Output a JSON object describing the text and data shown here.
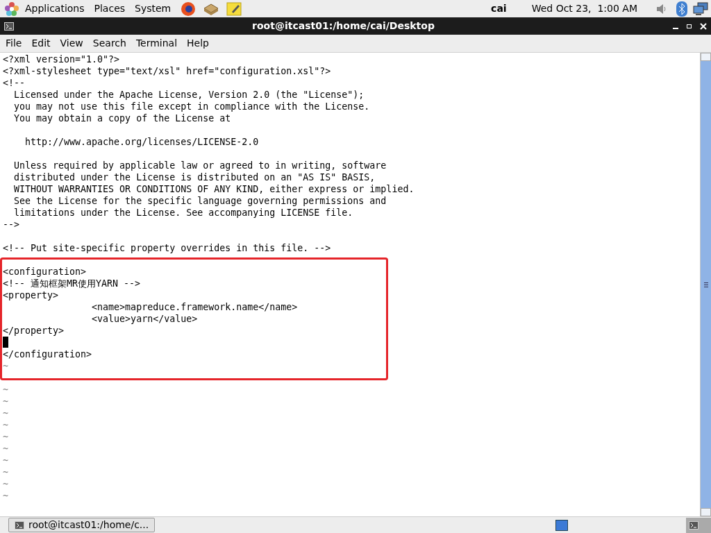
{
  "top_panel": {
    "menus": [
      "Applications",
      "Places",
      "System"
    ],
    "user": "cai",
    "clock": "Wed Oct 23,  1:00 AM"
  },
  "window": {
    "title": "root@itcast01:/home/cai/Desktop"
  },
  "menubar": [
    "File",
    "Edit",
    "View",
    "Search",
    "Terminal",
    "Help"
  ],
  "terminal": {
    "lines": [
      {
        "kind": "text",
        "text": "<?xml version=\"1.0\"?>"
      },
      {
        "kind": "text",
        "text": "<?xml-stylesheet type=\"text/xsl\" href=\"configuration.xsl\"?>"
      },
      {
        "kind": "text",
        "text": "<!--"
      },
      {
        "kind": "text",
        "text": "  Licensed under the Apache License, Version 2.0 (the \"License\");"
      },
      {
        "kind": "text",
        "text": "  you may not use this file except in compliance with the License."
      },
      {
        "kind": "text",
        "text": "  You may obtain a copy of the License at"
      },
      {
        "kind": "blank"
      },
      {
        "kind": "text",
        "text": "    http://www.apache.org/licenses/LICENSE-2.0"
      },
      {
        "kind": "blank"
      },
      {
        "kind": "text",
        "text": "  Unless required by applicable law or agreed to in writing, software"
      },
      {
        "kind": "text",
        "text": "  distributed under the License is distributed on an \"AS IS\" BASIS,"
      },
      {
        "kind": "text",
        "text": "  WITHOUT WARRANTIES OR CONDITIONS OF ANY KIND, either express or implied."
      },
      {
        "kind": "text",
        "text": "  See the License for the specific language governing permissions and"
      },
      {
        "kind": "text",
        "text": "  limitations under the License. See accompanying LICENSE file."
      },
      {
        "kind": "text",
        "text": "-->"
      },
      {
        "kind": "blank"
      },
      {
        "kind": "text",
        "text": "<!-- Put site-specific property overrides in this file. -->"
      },
      {
        "kind": "blank"
      },
      {
        "kind": "text",
        "text": "<configuration>"
      },
      {
        "kind": "text",
        "text": "<!-- 通知框架MR使用YARN -->"
      },
      {
        "kind": "text",
        "text": "<property>"
      },
      {
        "kind": "text",
        "text": "                <name>mapreduce.framework.name</name>"
      },
      {
        "kind": "text",
        "text": "                <value>yarn</value>"
      },
      {
        "kind": "text",
        "text": "</property>"
      },
      {
        "kind": "cursor"
      },
      {
        "kind": "text",
        "text": "</configuration>"
      },
      {
        "kind": "tilde",
        "text": "~"
      },
      {
        "kind": "blank"
      },
      {
        "kind": "tilde",
        "text": "~"
      },
      {
        "kind": "tilde",
        "text": "~"
      },
      {
        "kind": "tilde",
        "text": "~"
      },
      {
        "kind": "tilde",
        "text": "~"
      },
      {
        "kind": "tilde",
        "text": "~"
      },
      {
        "kind": "tilde",
        "text": "~"
      },
      {
        "kind": "tilde",
        "text": "~"
      },
      {
        "kind": "tilde",
        "text": "~"
      },
      {
        "kind": "tilde",
        "text": "~"
      },
      {
        "kind": "tilde",
        "text": "~"
      }
    ]
  },
  "taskbar": {
    "tasks": [
      {
        "label": "root@itcast01:/home/c...",
        "selected": false
      }
    ]
  }
}
